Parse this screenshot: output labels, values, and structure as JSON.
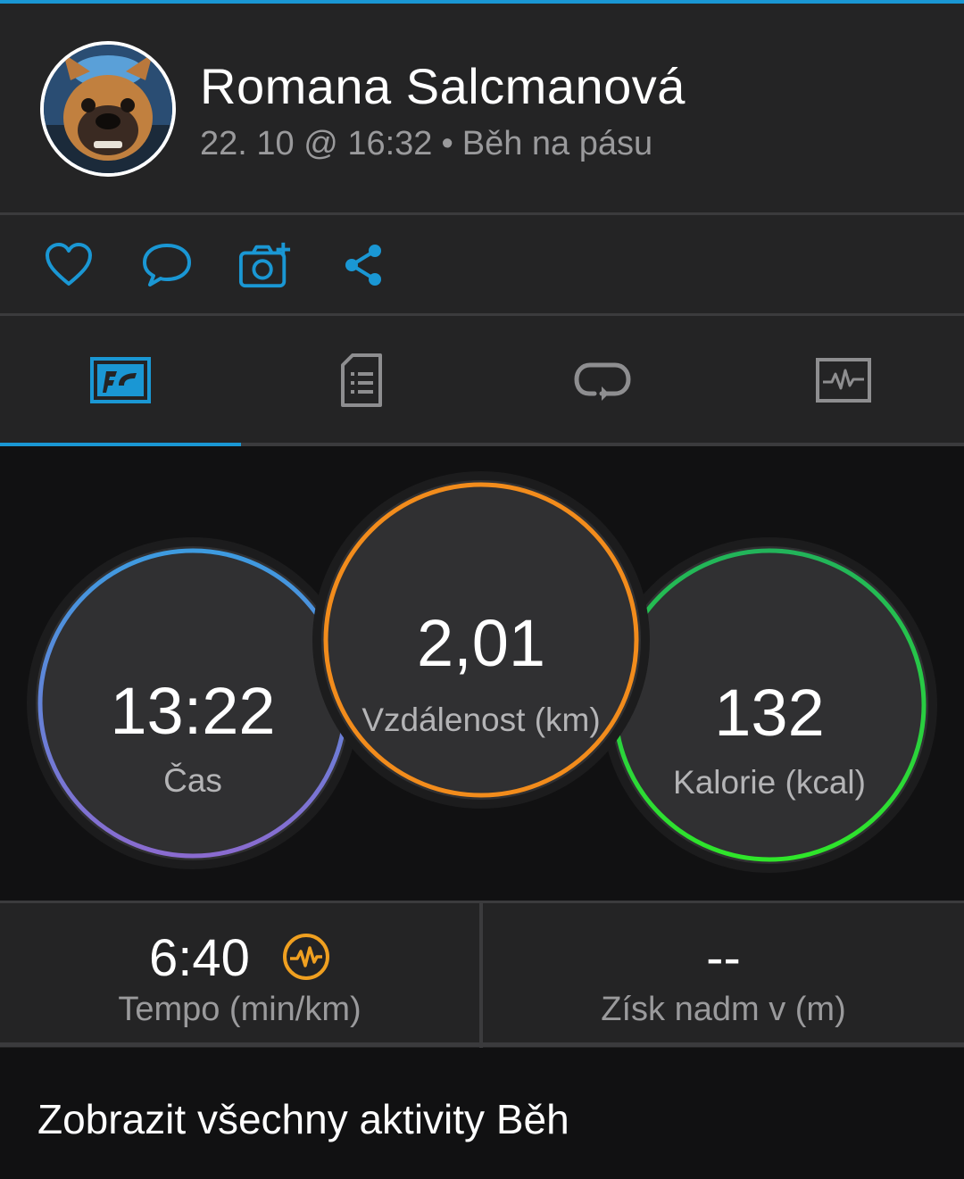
{
  "user": {
    "name": "Romana Salcmanová",
    "date": "22. 10 @ 16:32",
    "separator": "•",
    "activity_type": "Běh na pásu"
  },
  "actions": {
    "icons": [
      "heart-icon",
      "comment-icon",
      "add-photo-icon",
      "share-icon"
    ]
  },
  "tabs": {
    "items": [
      "stats-tab-icon",
      "details-tab-icon",
      "laps-tab-icon",
      "charts-tab-icon"
    ],
    "active_index": 0
  },
  "stats": {
    "time": {
      "value": "13:22",
      "label": "Čas"
    },
    "distance": {
      "value": "2,01",
      "label": "Vzdálenost (km)"
    },
    "calories": {
      "value": "132",
      "label": "Kalorie (kcal)"
    }
  },
  "metrics": {
    "pace": {
      "value": "6:40",
      "label": "Tempo (min/km)"
    },
    "elevation": {
      "value": "--",
      "label": "Získ nadm v (m)"
    }
  },
  "footer": {
    "link": "Zobrazit všechny aktivity Běh"
  },
  "colors": {
    "accent": "#1a97d4",
    "time_ring_start": "#3d9be0",
    "time_ring_end": "#8a6bd0",
    "distance_ring": "#f28c1c",
    "calories_ring_start": "#22c25a",
    "calories_ring_end": "#2fe62a",
    "pace_icon": "#f0a020"
  }
}
